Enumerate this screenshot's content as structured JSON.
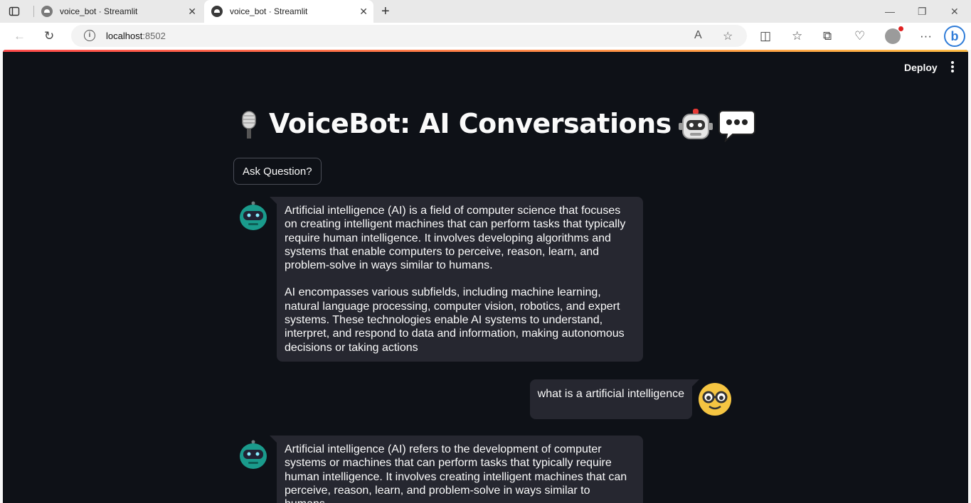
{
  "browser": {
    "tabs": [
      {
        "title": "voice_bot · Streamlit",
        "active": false
      },
      {
        "title": "voice_bot · Streamlit",
        "active": true
      }
    ],
    "url_host": "localhost",
    "url_port": ":8502"
  },
  "header": {
    "deploy_label": "Deploy"
  },
  "app": {
    "title": "VoiceBot: AI Conversations",
    "ask_button": "Ask Question?",
    "messages": [
      {
        "role": "assistant",
        "paragraphs": [
          "Artificial intelligence (AI) is a field of computer science that focuses on creating intelligent machines that can perform tasks that typically require human intelligence. It involves developing algorithms and systems that enable computers to perceive, reason, learn, and problem-solve in ways similar to humans.",
          "AI encompasses various subfields, including machine learning, natural language processing, computer vision, robotics, and expert systems. These technologies enable AI systems to understand, interpret, and respond to data and information, making autonomous decisions or taking actions"
        ]
      },
      {
        "role": "user",
        "text": "what is a artificial intelligence"
      },
      {
        "role": "assistant",
        "paragraphs": [
          "Artificial intelligence (AI) refers to the development of computer systems or machines that can perform tasks that typically require human intelligence. It involves creating intelligent machines that can perceive, reason, learn, and problem-solve in ways similar to humans."
        ]
      }
    ]
  },
  "colors": {
    "app_bg": "#0e1117",
    "bubble_bg": "#262730",
    "text": "#fafafa",
    "accent_gradient_start": "#ff4b4b",
    "accent_gradient_end": "#ffbd45"
  }
}
